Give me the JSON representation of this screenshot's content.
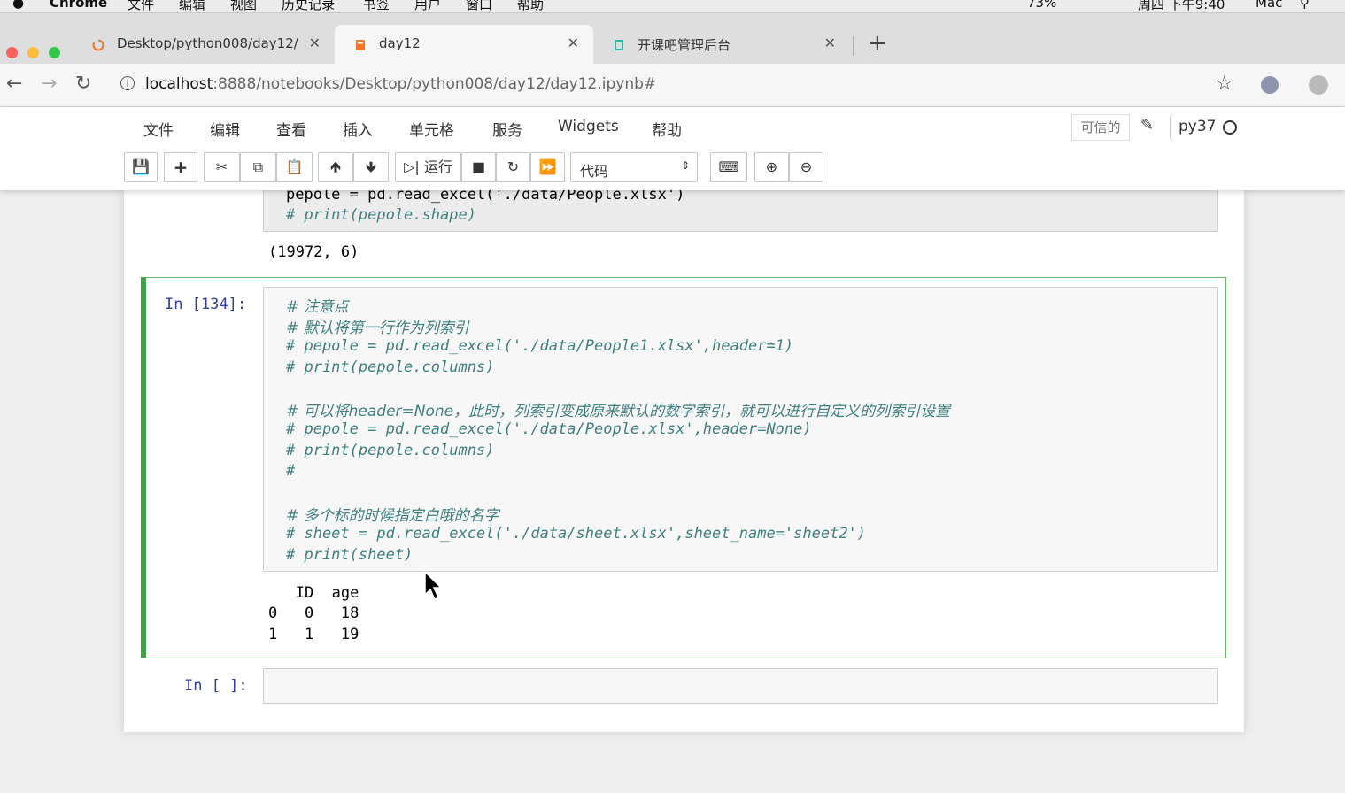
{
  "mac_menu": [
    "Chrome",
    "文件",
    "编辑",
    "视图",
    "历史记录",
    "书签",
    "用户",
    "窗口",
    "帮助"
  ],
  "mac_status": {
    "battery": "73%",
    "clock": "周四 下午9:40",
    "user": "Mac"
  },
  "tabs": [
    {
      "title": "Desktop/python008/day12/",
      "active": false
    },
    {
      "title": "day12",
      "active": true
    },
    {
      "title": "开课吧管理后台",
      "active": false
    }
  ],
  "address": {
    "host": "localhost",
    "path": ":8888/notebooks/Desktop/python008/day12/day12.ipynb#"
  },
  "menu": [
    "文件",
    "编辑",
    "查看",
    "插入",
    "单元格",
    "服务",
    "Widgets",
    "帮助"
  ],
  "trusted_label": "可信的",
  "kernel_name": "py37",
  "toolbar": {
    "run_label": "运行",
    "cell_type": "代码"
  },
  "cells": {
    "prev": {
      "code_line1": "pepole = pd.read_excel('./data/People.xlsx')",
      "code_line2": "# print(pepole.shape)",
      "output": "(19972, 6)"
    },
    "current": {
      "prompt": "In [134]:",
      "lines": [
        "# 注意点",
        "# 默认将第一行作为列索引",
        "# pepole = pd.read_excel('./data/People1.xlsx',header=1)",
        "# print(pepole.columns)",
        "",
        "# 可以将header=None，此时，列索引变成原来默认的数字索引，就可以进行自定义的列索引设置",
        "# pepole = pd.read_excel('./data/People.xlsx',header=None)",
        "# print(pepole.columns)",
        "#",
        "",
        "# 多个标的时候指定白哦的名字",
        "# sheet = pd.read_excel('./data/sheet.xlsx',sheet_name='sheet2')",
        "# print(sheet)"
      ],
      "output_lines": [
        "   ID  age",
        "0   0   18",
        "1   1   19"
      ]
    },
    "empty": {
      "prompt": "In [ ]:"
    }
  }
}
